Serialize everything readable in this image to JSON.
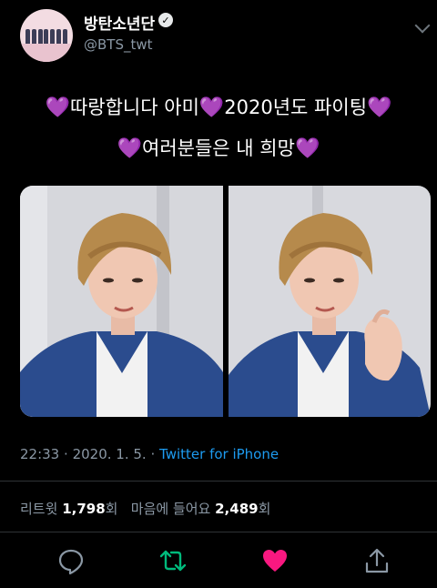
{
  "account": {
    "display_name": "방탄소년단",
    "handle": "@BTS_twt",
    "verified": true
  },
  "tweet": {
    "line1_part1": "따랑합니다 아미",
    "line1_part2": "2020년도 파이팅",
    "line2": "여러분들은 내 희망",
    "emoji": "💜",
    "time": "22:33",
    "date": "2020. 1. 5.",
    "source": "Twitter for iPhone",
    "separator": "·"
  },
  "stats": {
    "retweets_label": "리트윗",
    "retweets_count": "1,798",
    "likes_label": "마음에 들어요",
    "likes_count": "2,489",
    "unit": "회"
  },
  "actions": [
    "reply-icon",
    "retweet-icon",
    "like-icon",
    "share-icon"
  ],
  "colors": {
    "background": "#000000",
    "muted": "#8b98a5",
    "link": "#1d9bf0",
    "retweet_green": "#00ba7c",
    "like_red": "#f91880",
    "heart_purple": "#9a51e6"
  }
}
